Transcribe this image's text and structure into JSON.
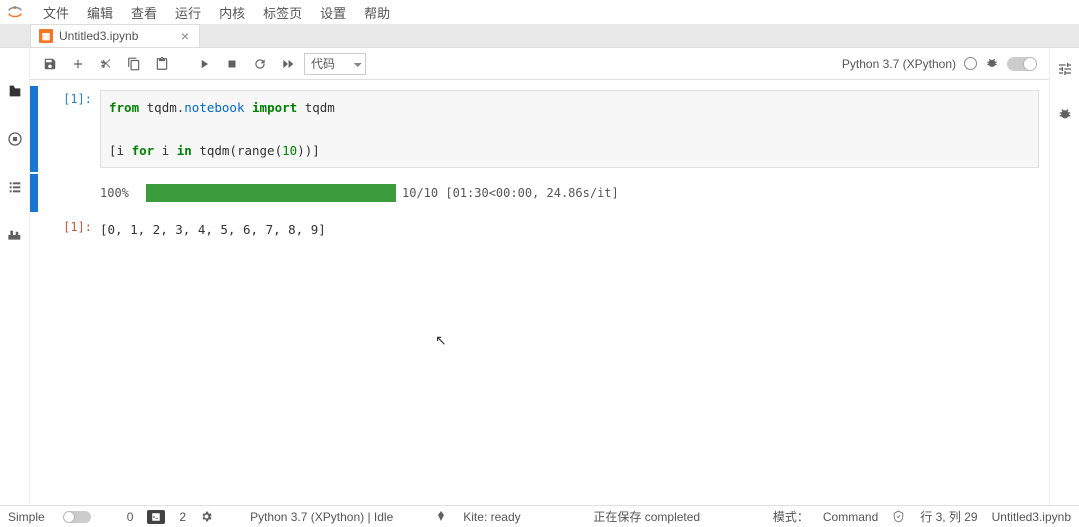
{
  "menu": {
    "file": "文件",
    "edit": "编辑",
    "view": "查看",
    "run": "运行",
    "kernel": "内核",
    "tabs": "标签页",
    "settings": "设置",
    "help": "帮助"
  },
  "tab": {
    "title": "Untitled3.ipynb",
    "icon_glyph": "📓"
  },
  "toolbar": {
    "cell_type": "代码",
    "kernel_label": "Python 3.7 (XPython)"
  },
  "cells": {
    "in1_prompt": "[1]:",
    "in1_code_tokens": {
      "from": "from",
      "mod1": "tqdm",
      "dot": ".",
      "mod2": "notebook",
      "import": "import",
      "sym": "tqdm",
      "line2_pre": "[i ",
      "for": "for",
      "mid1": " i ",
      "in": "in",
      "mid2": " tqdm(",
      "range": "range",
      "open": "(",
      "num": "10",
      "close": "))]"
    },
    "progress_pct": "100%",
    "progress_text": "10/10 [01:30<00:00, 24.86s/it]",
    "out1_prompt": "[1]:",
    "out1_text": "[0, 1, 2, 3, 4, 5, 6, 7, 8, 9]"
  },
  "status": {
    "simple": "Simple",
    "warn_count": "0",
    "term_count": "2",
    "kernel_full": "Python 3.7 (XPython) | Idle",
    "kite": "Kite: ready",
    "saving": "正在保存 completed",
    "mode_label": "模式：",
    "mode_value": "Command",
    "cursor": "行 3, 列 29",
    "filename": "Untitled3.ipynb"
  }
}
